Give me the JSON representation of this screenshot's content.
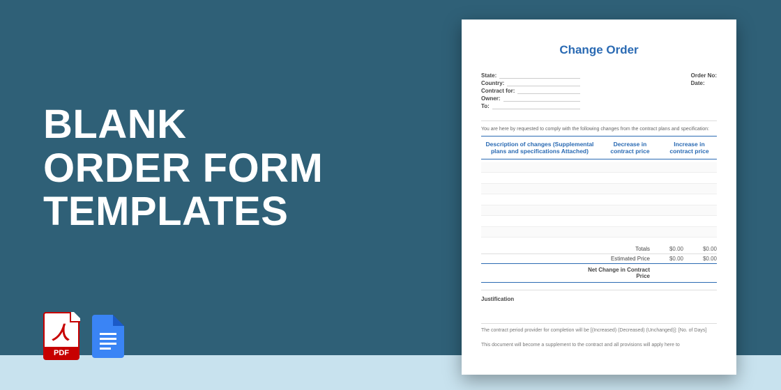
{
  "hero": {
    "line1": "BLANK",
    "line2": "ORDER FORM",
    "line3": "TEMPLATES"
  },
  "icons": {
    "pdf_label": "PDF",
    "pdf_swoosh": "人"
  },
  "doc": {
    "title": "Change Order",
    "meta_left": [
      "State:",
      "Country:",
      "Contract for:",
      "Owner:",
      "To:"
    ],
    "meta_right": [
      "Order No:",
      "Date:"
    ],
    "intro": "You are here by requested to comply with the following changes from the contract plans and specification:",
    "headers": {
      "c1": "Description of changes (Supplemental plans and specifications Attached)",
      "c2": "Decrease in contract price",
      "c3": "Increase in contract price"
    },
    "totals": {
      "totals_label": "Totals",
      "estimated_label": "Estimated Price",
      "net_label": "Net Change in Contract Price",
      "zero": "$0.00"
    },
    "justification_label": "Justification",
    "footnote1": "The contract period provider for completion will be [(Increased) (Decreased) (Unchanged)]: [No. of Days]",
    "footnote2": "This document will become a supplement to the contract and all provisions will apply here to"
  }
}
